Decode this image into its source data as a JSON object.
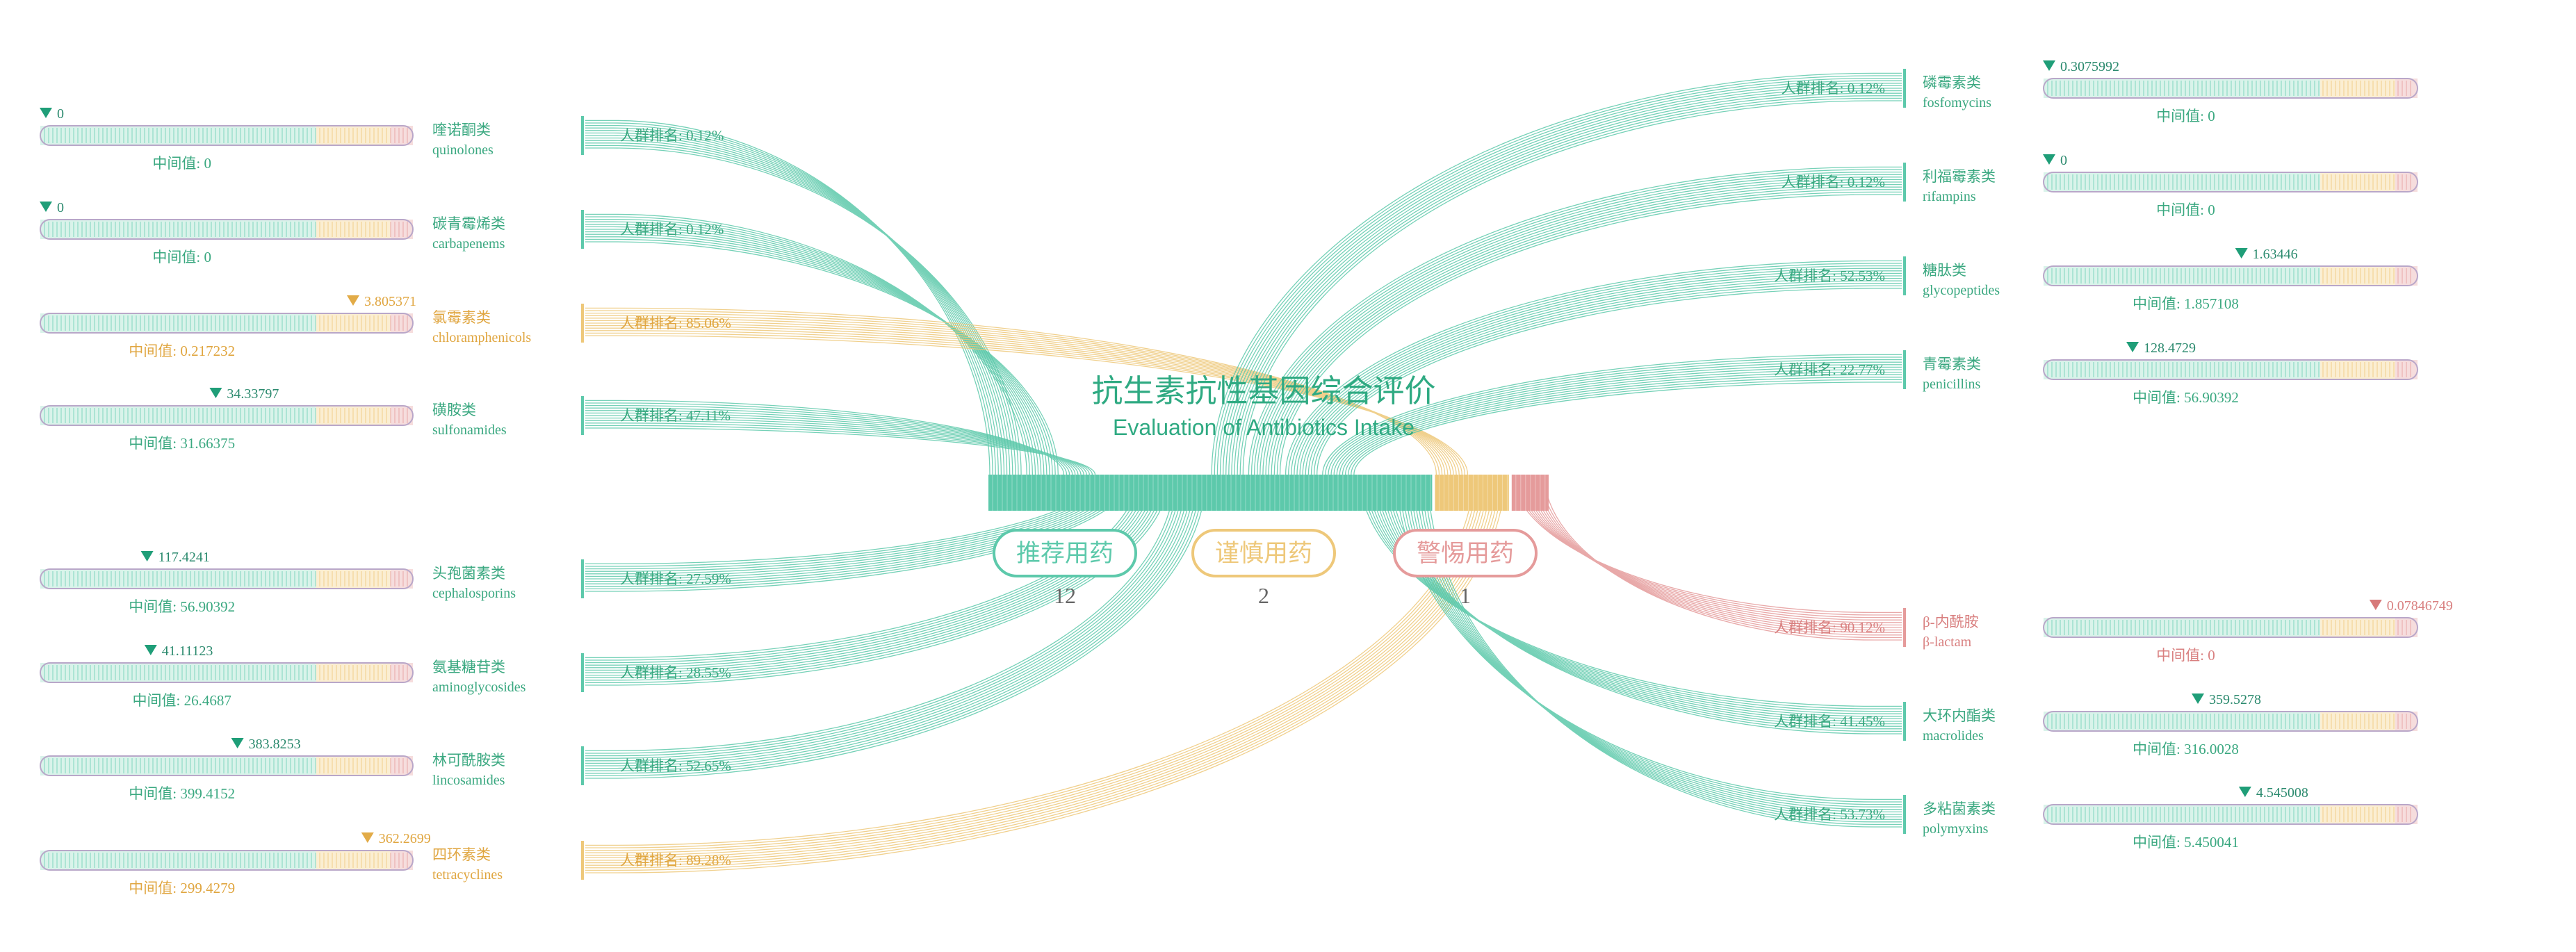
{
  "chart_data": {
    "type": "sankey",
    "title": "抗生素抗性基因综合评价",
    "subtitle": "Evaluation of Antibiotics Intake",
    "colors": {
      "recommend": "#5dc9ab",
      "caution": "#eec87a",
      "alert": "#e59b9b",
      "recommend_text": "#3aa880",
      "caution_text": "#e0a640",
      "alert_text": "#d98080",
      "number_text": "#666666"
    },
    "categories": [
      {
        "key": "recommend",
        "label": "推荐用药",
        "count": "12",
        "share": 12
      },
      {
        "key": "caution",
        "label": "谨慎用药",
        "count": "2",
        "share": 2
      },
      {
        "key": "alert",
        "label": "警惕用药",
        "count": "1",
        "share": 1
      }
    ],
    "median_prefix": "中间值: ",
    "rank_prefix": "人群排名: ",
    "left_items": [
      {
        "zh": "喹诺酮类",
        "en": "quinolones",
        "status": "recommend",
        "marker_label": "0",
        "marker_pos": 0.0,
        "median": "0",
        "rank": "0.12%"
      },
      {
        "zh": "碳青霉烯类",
        "en": "carbapenems",
        "status": "recommend",
        "marker_label": "0",
        "marker_pos": 0.0,
        "median": "0",
        "rank": "0.12%"
      },
      {
        "zh": "氯霉素类",
        "en": "chloramphenicols",
        "status": "caution",
        "marker_label": "3.805371",
        "marker_pos": 0.85,
        "median": "0.217232",
        "rank": "85.06%"
      },
      {
        "zh": "磺胺类",
        "en": "sulfonamides",
        "status": "recommend",
        "marker_label": "34.33797",
        "marker_pos": 0.47,
        "median": "31.66375",
        "rank": "47.11%"
      },
      {
        "zh": "头孢菌素类",
        "en": "cephalosporins",
        "status": "recommend",
        "marker_label": "117.4241",
        "marker_pos": 0.28,
        "median": "56.90392",
        "rank": "27.59%"
      },
      {
        "zh": "氨基糖苷类",
        "en": "aminoglycosides",
        "status": "recommend",
        "marker_label": "41.11123",
        "marker_pos": 0.29,
        "median": "26.4687",
        "rank": "28.55%"
      },
      {
        "zh": "林可酰胺类",
        "en": "lincosamides",
        "status": "recommend",
        "marker_label": "383.8253",
        "marker_pos": 0.53,
        "median": "399.4152",
        "rank": "52.65%"
      },
      {
        "zh": "四环素类",
        "en": "tetracyclines",
        "status": "caution",
        "marker_label": "362.2699",
        "marker_pos": 0.89,
        "median": "299.4279",
        "rank": "89.28%"
      }
    ],
    "right_items": [
      {
        "zh": "磷霉素类",
        "en": "fosfomycins",
        "status": "recommend",
        "marker_label": "0.3075992",
        "marker_pos": 0.0,
        "median": "0",
        "rank": "0.12%"
      },
      {
        "zh": "利福霉素类",
        "en": "rifampins",
        "status": "recommend",
        "marker_label": "0",
        "marker_pos": 0.0,
        "median": "0",
        "rank": "0.12%"
      },
      {
        "zh": "糖肽类",
        "en": "glycopeptides",
        "status": "recommend",
        "marker_label": "1.63446",
        "marker_pos": 0.53,
        "median": "1.857108",
        "rank": "52.53%"
      },
      {
        "zh": "青霉素类",
        "en": "penicillins",
        "status": "recommend",
        "marker_label": "128.4729",
        "marker_pos": 0.23,
        "median": "56.90392",
        "rank": "22.77%"
      },
      {
        "zh": "β-内酰胺",
        "en": "β-lactam",
        "status": "alert",
        "marker_label": "0.07846749",
        "marker_pos": 0.9,
        "median": "0",
        "rank": "90.12%"
      },
      {
        "zh": "大环内酯类",
        "en": "macrolides",
        "status": "recommend",
        "marker_label": "359.5278",
        "marker_pos": 0.41,
        "median": "316.0028",
        "rank": "41.45%"
      },
      {
        "zh": "多粘菌素类",
        "en": "polymyxins",
        "status": "recommend",
        "marker_label": "4.545008",
        "marker_pos": 0.54,
        "median": "5.450041",
        "rank": "53.73%"
      }
    ]
  }
}
